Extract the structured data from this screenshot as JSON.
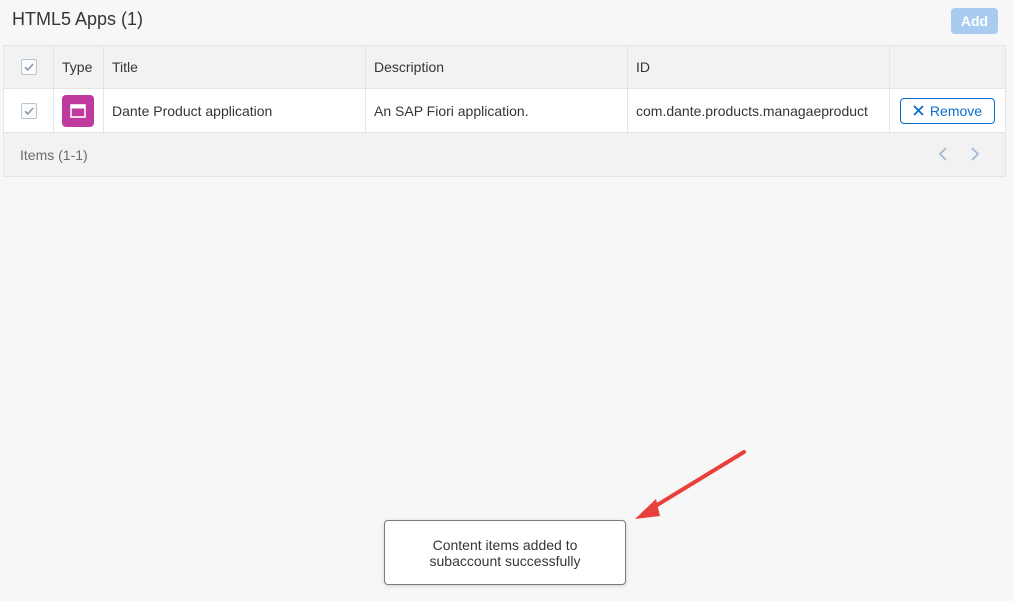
{
  "header": {
    "title": "HTML5 Apps (1)",
    "add_label": "Add"
  },
  "table": {
    "columns": {
      "type": "Type",
      "title": "Title",
      "description": "Description",
      "id": "ID"
    },
    "rows": [
      {
        "selected": true,
        "type_icon": "app-window-icon",
        "title": "Dante Product application",
        "description": "An SAP Fiori application.",
        "id": "com.dante.products.managaeproduct",
        "action_label": "Remove"
      }
    ],
    "footer": {
      "items_label": "Items (1-1)"
    }
  },
  "toast": {
    "message": "Content items added to subaccount successfully"
  },
  "colors": {
    "accent": "#0a6ed1",
    "add_button_disabled": "#a9cbef",
    "type_tile": "#c0399f",
    "annotation_arrow": "#e8413b"
  }
}
